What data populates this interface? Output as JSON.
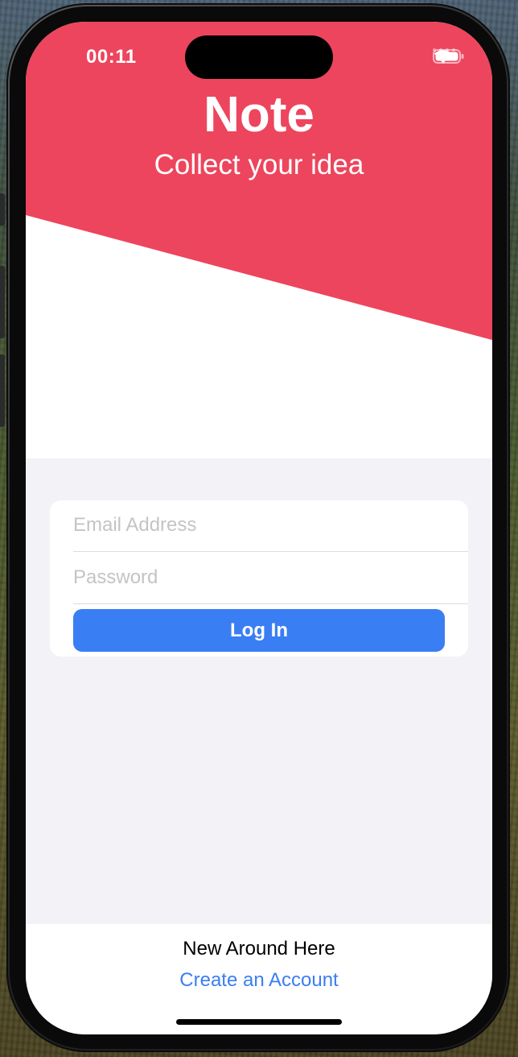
{
  "status_bar": {
    "time": "00:11",
    "icons": [
      "cellular-signal-icon",
      "wifi-icon",
      "battery-icon"
    ]
  },
  "header": {
    "title": "Note",
    "subtitle": "Collect your idea"
  },
  "login_form": {
    "email": {
      "placeholder": "Email Address",
      "value": ""
    },
    "password": {
      "placeholder": "Password",
      "value": ""
    },
    "login_label": "Log In"
  },
  "footer": {
    "prompt": "New Around Here",
    "create_account_label": "Create an Account"
  },
  "colors": {
    "accent_red": "#ED455D",
    "primary_blue": "#3A7EF3",
    "form_background": "#F2F2F7"
  }
}
